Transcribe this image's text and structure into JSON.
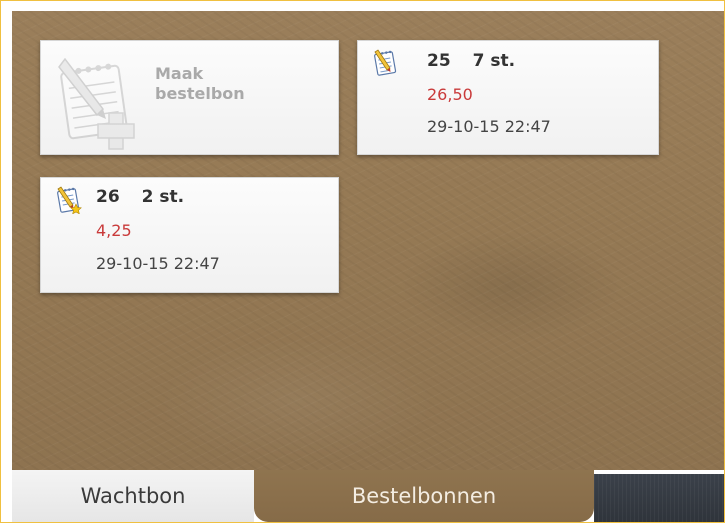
{
  "new_order": {
    "label_line1": "Maak",
    "label_line2": "bestelbon",
    "icon": "notepad-add-icon"
  },
  "orders": [
    {
      "number": "25",
      "quantity": "7 st.",
      "amount": "26,50",
      "datetime": "29-10-15 22:47",
      "icon": "order-notepad-icon"
    },
    {
      "number": "26",
      "quantity": "2 st.",
      "amount": "4,25",
      "datetime": "29-10-15 22:47",
      "icon": "order-notepad-star-icon"
    }
  ],
  "tabs": {
    "wachtbon": "Wachtbon",
    "bestelbonnen": "Bestelbonnen"
  },
  "colors": {
    "amount": "#c93a3a",
    "board": "#967a55",
    "dark_tab": "#353a42"
  }
}
